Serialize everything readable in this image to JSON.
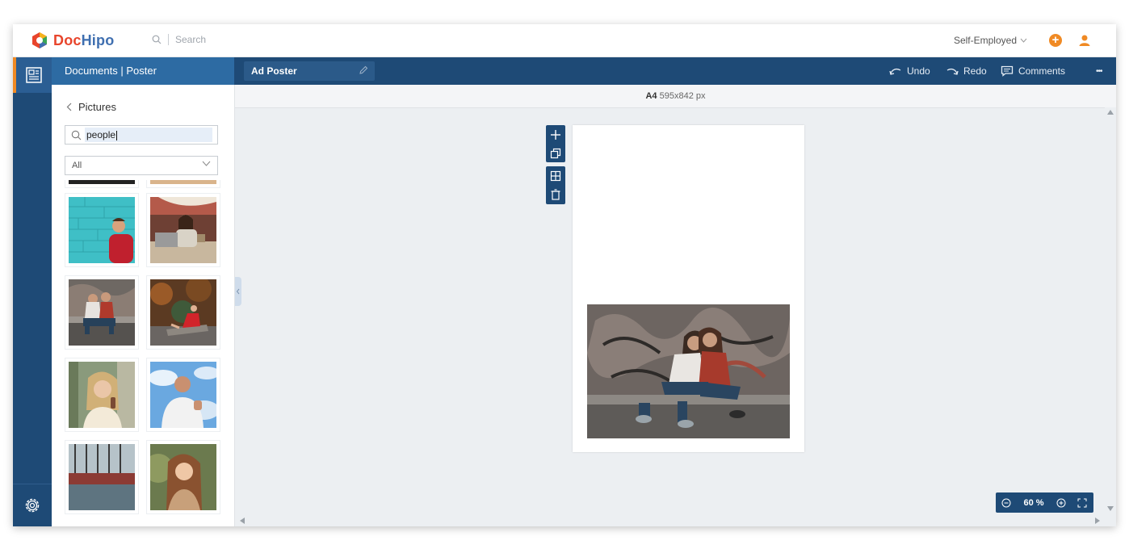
{
  "header": {
    "logo_text_d": "Doc",
    "logo_text_h": "Hipo",
    "search_placeholder": "Search",
    "account_label": "Self-Employed",
    "add_label": "+"
  },
  "toolbar": {
    "breadcrumb": "Documents | Poster",
    "document_title": "Ad Poster",
    "undo_label": "Undo",
    "redo_label": "Redo",
    "comments_label": "Comments",
    "more_label": "•••"
  },
  "side_panel": {
    "back_label": "Pictures",
    "search_value": "people",
    "filter_selected": "All"
  },
  "canvas": {
    "size_prefix": "A4",
    "size_value": "595x842 px",
    "zoom_value": "60 %"
  },
  "colors": {
    "brand_dark": "#1e4a76",
    "brand_mid": "#2d6ba3",
    "accent": "#f08a24",
    "logo_red": "#e8452c",
    "logo_blue": "#3f6fb0"
  }
}
